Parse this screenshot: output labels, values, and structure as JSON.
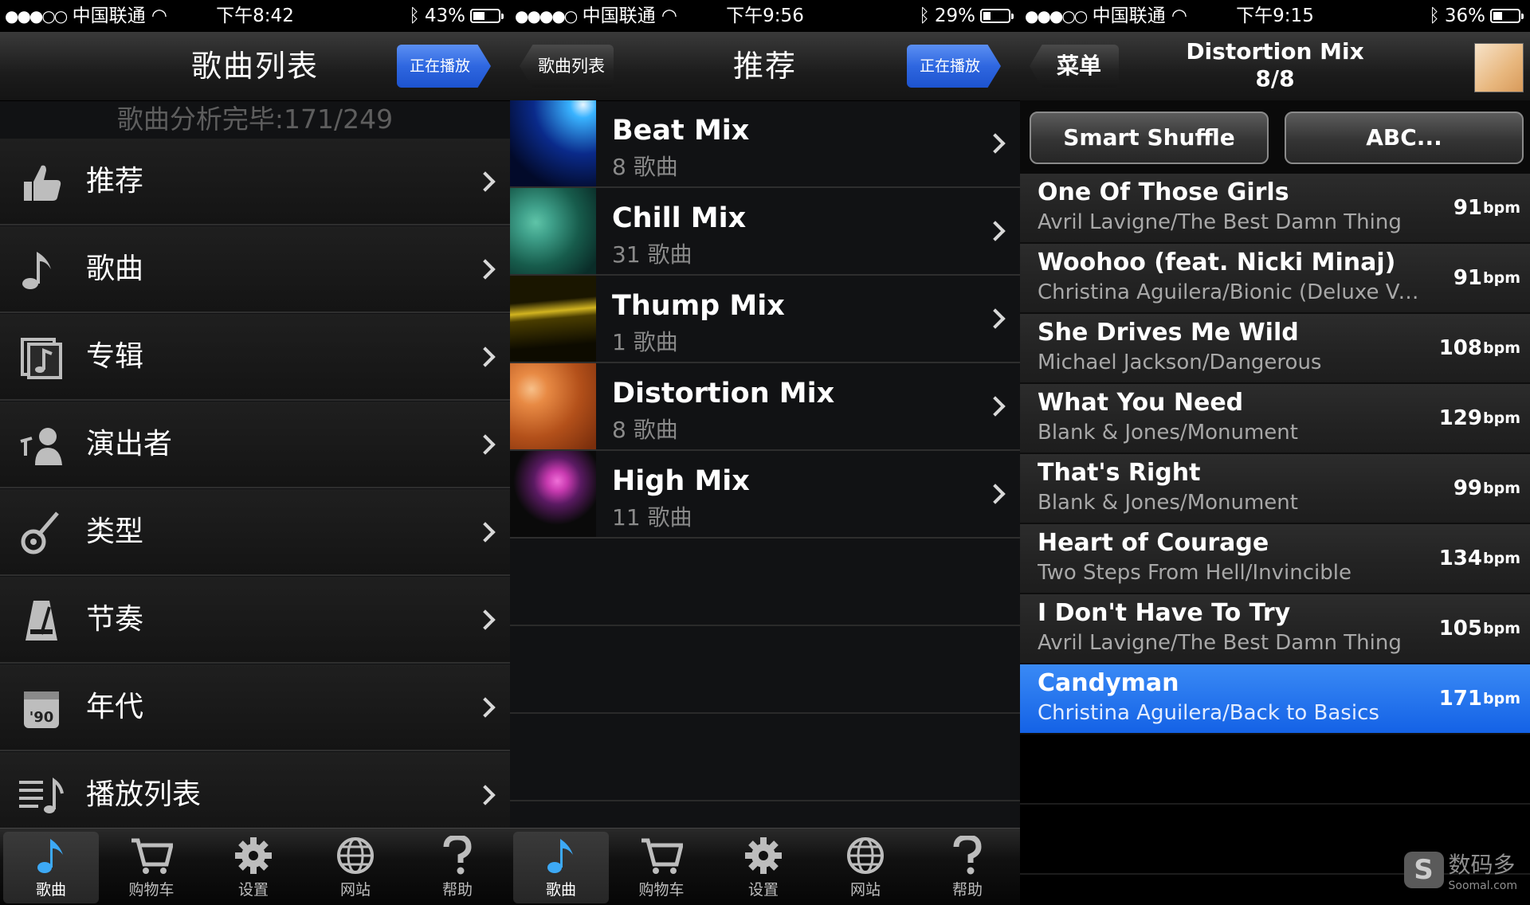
{
  "screens": [
    {
      "status": {
        "carrier": "中国联通",
        "time": "下午8:42",
        "battery": "43%",
        "battery_level": 0.43
      },
      "nav": {
        "title": "歌曲列表",
        "right_button": "正在播放"
      },
      "subtitle": "歌曲分析完毕:171/249",
      "menu": [
        {
          "label": "推荐",
          "icon": "thumbs-up-icon"
        },
        {
          "label": "歌曲",
          "icon": "music-note-icon"
        },
        {
          "label": "专辑",
          "icon": "album-icon"
        },
        {
          "label": "演出者",
          "icon": "artist-icon"
        },
        {
          "label": "类型",
          "icon": "guitar-icon"
        },
        {
          "label": "节奏",
          "icon": "metronome-icon"
        },
        {
          "label": "年代",
          "icon": "calendar-icon",
          "badge": "'90"
        },
        {
          "label": "播放列表",
          "icon": "playlist-icon"
        }
      ]
    },
    {
      "status": {
        "carrier": "中国联通",
        "time": "下午9:56",
        "battery": "29%",
        "battery_level": 0.29
      },
      "nav": {
        "title": "推荐",
        "back_button": "歌曲列表",
        "right_button": "正在播放"
      },
      "mixes": [
        {
          "name": "Beat Mix",
          "count": "8 歌曲",
          "colors": [
            "#0a2a8a",
            "#39b3ff"
          ]
        },
        {
          "name": "Chill Mix",
          "count": "31 歌曲",
          "colors": [
            "#0e4a3f",
            "#3fa08a"
          ]
        },
        {
          "name": "Thump Mix",
          "count": "1 歌曲",
          "colors": [
            "#1a1600",
            "#d2b420"
          ]
        },
        {
          "name": "Distortion Mix",
          "count": "8 歌曲",
          "colors": [
            "#b3501a",
            "#f2a35a"
          ]
        },
        {
          "name": "High Mix",
          "count": "11 歌曲",
          "colors": [
            "#0a0a0a",
            "#c83ab0"
          ]
        }
      ]
    },
    {
      "status": {
        "carrier": "中国联通",
        "time": "下午9:15",
        "battery": "36%",
        "battery_level": 0.36
      },
      "nav": {
        "title": "Distortion Mix",
        "subtitle": "8/8",
        "back_button": "菜单"
      },
      "buttons": {
        "shuffle": "Smart Shuffle",
        "abc": "ABC..."
      },
      "songs": [
        {
          "title": "One Of Those Girls",
          "artist": "Avril Lavigne/The Best Damn Thing",
          "bpm": "91"
        },
        {
          "title": "Woohoo (feat. Nicki Minaj)",
          "artist": "Christina Aguilera/Bionic (Deluxe Ve…",
          "bpm": "91"
        },
        {
          "title": "She Drives Me Wild",
          "artist": "Michael Jackson/Dangerous",
          "bpm": "108"
        },
        {
          "title": "What You Need",
          "artist": "Blank & Jones/Monument",
          "bpm": "129"
        },
        {
          "title": "That's Right",
          "artist": "Blank & Jones/Monument",
          "bpm": "99"
        },
        {
          "title": "Heart of Courage",
          "artist": "Two Steps From Hell/Invincible",
          "bpm": "134"
        },
        {
          "title": "I Don't Have To Try",
          "artist": "Avril Lavigne/The Best Damn Thing",
          "bpm": "105"
        },
        {
          "title": "Candyman",
          "artist": "Christina Aguilera/Back to Basics",
          "bpm": "171",
          "selected": true
        }
      ],
      "bpm_unit": "bpm",
      "watermark": {
        "title": "数码多",
        "url": "Soomal.com"
      }
    }
  ],
  "tabbar": [
    {
      "label": "歌曲",
      "icon": "music-note-icon",
      "active": true
    },
    {
      "label": "购物车",
      "icon": "cart-icon"
    },
    {
      "label": "设置",
      "icon": "gear-icon"
    },
    {
      "label": "网站",
      "icon": "globe-icon"
    },
    {
      "label": "帮助",
      "icon": "help-icon"
    }
  ],
  "colors": {
    "accent_blue": "#2f67e0",
    "selection_blue": "#1f6fee",
    "background": "#111214"
  }
}
